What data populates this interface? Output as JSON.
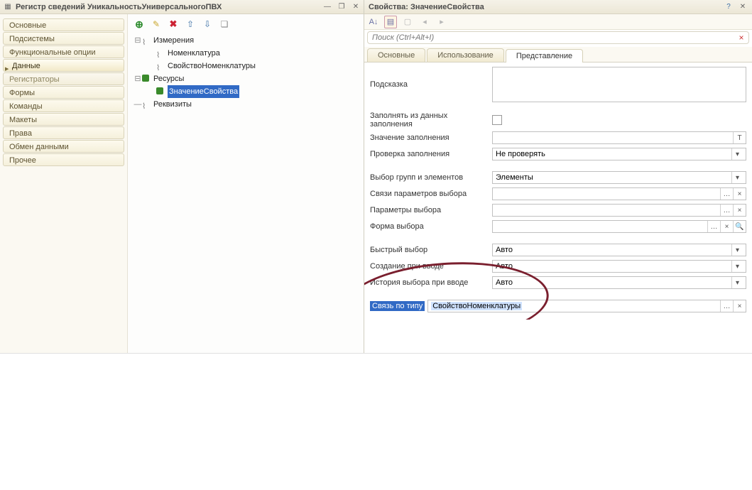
{
  "left": {
    "title": "Регистр сведений УникальностьУниверсальногоПВХ",
    "sidebar": {
      "items": [
        {
          "label": "Основные"
        },
        {
          "label": "Подсистемы"
        },
        {
          "label": "Функциональные опции"
        },
        {
          "label": "Данные",
          "active": true
        },
        {
          "label": "Регистраторы",
          "sub": true
        },
        {
          "label": "Формы"
        },
        {
          "label": "Команды"
        },
        {
          "label": "Макеты"
        },
        {
          "label": "Права"
        },
        {
          "label": "Обмен данными"
        },
        {
          "label": "Прочее"
        }
      ]
    },
    "tree": {
      "groups": [
        {
          "label": "Измерения",
          "children": [
            "Номенклатура",
            "СвойствоНоменклатуры"
          ]
        },
        {
          "label": "Ресурсы",
          "children": [
            "ЗначениеСвойства"
          ],
          "selected": 0
        },
        {
          "label": "Реквизиты",
          "children": []
        }
      ]
    }
  },
  "right": {
    "title": "Свойства: ЗначениеСвойства",
    "search_placeholder": "Поиск (Ctrl+Alt+I)",
    "tabs": [
      "Основные",
      "Использование",
      "Представление"
    ],
    "active_tab": 2,
    "labels": {
      "hint": "Подсказка",
      "fill_from_data": "Заполнять из данных заполнения",
      "fill_value": "Значение заполнения",
      "fill_check": "Проверка заполнения",
      "group_sel": "Выбор групп и элементов",
      "param_links": "Связи параметров выбора",
      "sel_params": "Параметры выбора",
      "sel_form": "Форма выбора",
      "quick_sel": "Быстрый выбор",
      "create_on_input": "Создание при вводе",
      "input_history": "История выбора при вводе",
      "link_by_type": "Связь по типу"
    },
    "values": {
      "fill_check": "Не проверять",
      "group_sel": "Элементы",
      "quick_sel": "Авто",
      "create_on_input": "Авто",
      "input_history": "Авто",
      "link_by_type": "СвойствоНоменклатуры"
    }
  },
  "glyphs": {
    "min": "—",
    "restore": "❐",
    "close": "✕",
    "drop": "▾",
    "dots": "…",
    "x": "×",
    "mag": "🔍",
    "t": "T",
    "help": "?"
  }
}
